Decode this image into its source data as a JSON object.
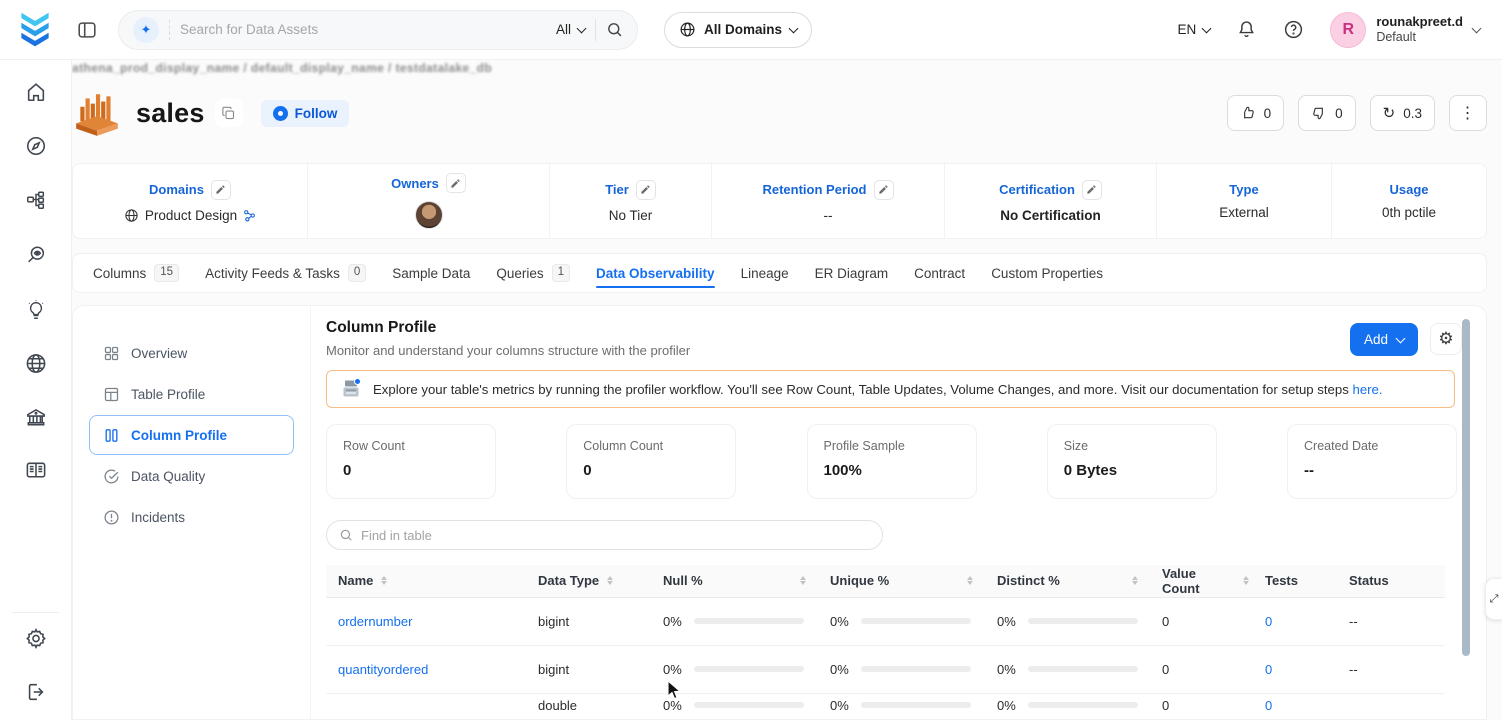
{
  "colors": {
    "accent": "#1570ef",
    "banner_border": "#f6bd88",
    "avatar_bg": "#fbd0e4"
  },
  "topbar": {
    "search": {
      "placeholder": "Search for Data Assets",
      "scope": "All"
    },
    "domains_filter": "All Domains",
    "language": "EN",
    "user": {
      "name": "rounakpreet.d",
      "team": "Default",
      "initial": "R"
    }
  },
  "breadcrumb": "athena_prod_display_name  /  default_display_name  /  testdatalake_db",
  "entity": {
    "name": "sales",
    "follow_label": "Follow",
    "upvotes": "0",
    "downvotes": "0",
    "version": "0.3"
  },
  "metadata": {
    "items": [
      {
        "label": "Domains",
        "value": "Product Design"
      },
      {
        "label": "Owners",
        "value": ""
      },
      {
        "label": "Tier",
        "value": "No Tier"
      },
      {
        "label": "Retention Period",
        "value": "--"
      },
      {
        "label": "Certification",
        "value": "No Certification"
      },
      {
        "label": "Type",
        "value": "External"
      },
      {
        "label": "Usage",
        "value": "0th pctile"
      }
    ]
  },
  "tabs": [
    {
      "label": "Columns",
      "count": "15"
    },
    {
      "label": "Activity Feeds & Tasks",
      "count": "0"
    },
    {
      "label": "Sample Data"
    },
    {
      "label": "Queries",
      "count": "1"
    },
    {
      "label": "Data Observability"
    },
    {
      "label": "Lineage"
    },
    {
      "label": "ER Diagram"
    },
    {
      "label": "Contract"
    },
    {
      "label": "Custom Properties"
    }
  ],
  "profiler_nav": [
    {
      "label": "Overview"
    },
    {
      "label": "Table Profile"
    },
    {
      "label": "Column Profile"
    },
    {
      "label": "Data Quality"
    },
    {
      "label": "Incidents"
    }
  ],
  "profile": {
    "title": "Column Profile",
    "subtitle": "Monitor and understand your columns structure with the profiler",
    "add_label": "Add",
    "banner": {
      "text": "Explore your table's metrics by running the profiler workflow. You'll see Row Count, Table Updates, Volume Changes, and more. Visit our documentation for setup steps",
      "link": "here."
    },
    "stats": [
      {
        "label": "Row Count",
        "value": "0"
      },
      {
        "label": "Column Count",
        "value": "0"
      },
      {
        "label": "Profile Sample",
        "value": "100%"
      },
      {
        "label": "Size",
        "value": "0 Bytes"
      },
      {
        "label": "Created Date",
        "value": "--"
      }
    ],
    "find_placeholder": "Find in table",
    "table": {
      "headers": [
        "Name",
        "Data Type",
        "Null %",
        "Unique %",
        "Distinct %",
        "Value Count",
        "Tests",
        "Status"
      ],
      "rows": [
        {
          "name": "ordernumber",
          "type": "bigint",
          "null_pct": "0%",
          "unique_pct": "0%",
          "distinct_pct": "0%",
          "value_count": "0",
          "tests": "0",
          "status": "--"
        },
        {
          "name": "quantityordered",
          "type": "bigint",
          "null_pct": "0%",
          "unique_pct": "0%",
          "distinct_pct": "0%",
          "value_count": "0",
          "tests": "0",
          "status": "--"
        },
        {
          "name": "",
          "type": "double",
          "null_pct": "0%",
          "unique_pct": "0%",
          "distinct_pct": "0%",
          "value_count": "0",
          "tests": "0",
          "status": ""
        }
      ]
    }
  }
}
